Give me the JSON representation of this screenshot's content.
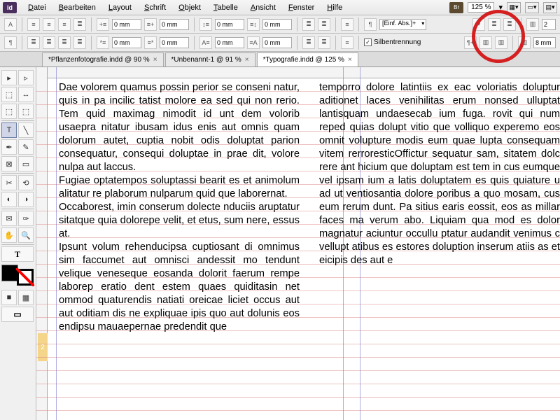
{
  "app_logo": "Id",
  "menu": [
    "Datei",
    "Bearbeiten",
    "Layout",
    "Schrift",
    "Objekt",
    "Tabelle",
    "Ansicht",
    "Fenster",
    "Hilfe"
  ],
  "bridge_badge": "Br",
  "zoom": "125 %",
  "control_bar": {
    "A_label": "A",
    "indent_left": "0 mm",
    "indent_right": "0 mm",
    "first_line": "0 mm",
    "space_before": "0 mm",
    "space_after": "0 mm",
    "para_style": "[Einf. Abs.]+",
    "hyphenation_label": "Silbentrennung",
    "hyphenation_checked": true,
    "columns": "2",
    "gutter": "8 mm"
  },
  "tabs": [
    {
      "label": "*Pflanzenfotografie.indd @ 90 %",
      "active": false
    },
    {
      "label": "*Unbenannt-1 @ 91 %",
      "active": false
    },
    {
      "label": "*Typografie.indd @ 125 %",
      "active": true
    }
  ],
  "page_number": "2",
  "text": {
    "col1_p1": "Dae volorem quamus possin perior se conseni na­tur, quis in pa incilic tatist molore ea sed qui non rerio. Tem quid maximag nimodit id unt dem vo­lorib usaepra nitatur ibusam idus enis aut omnis quam dolorum autet, cuptia nobit odis doluptat parion consequatur, consequi doluptae in prae dit, volore nulpa aut laccus.",
    "col1_p2": "Fugiae optatempos soluptassi bearit es et animo­lum alitatur re plaborum nulparum quid que la­borernat.",
    "col1_p3": "Occaborest, imin conserum dolecte nduciis arup­tatur sitatque quia dolorepe velit, et etus, sum ne­re, essus at.",
    "col1_p4": "Ipsunt volum rehenducipsa cuptiosant di omni­mus sim faccumet aut omnisci andessit mo tend­unt velique veneseque eosanda dolorit faerum rempe laborep eratio dent estem quaes quiditasin net ommod quaturendis natiati oreicae liciet oc­cus aut aut oditiam dis ne expliquae ipis quo aut dolunis eos endipsu mauaepernae predendit que",
    "col2_p1": "temporro dolore latintiis ex eac voloriatis doluptur aditionet laces venihilitas erum nonsed ulluptat lantisquam undaesecab ium fuga. rovit qui num reped quias dolupt vitio que volliquo experemo eos omnit volupture modis eum quae lupta consequam vitem rerroresticOffictur sequatur sam, sitatem dolc rere ant hicium que doluptam est tem in cus eumque vel ipsam ium a latis doluptatem es quis quiature u ad ut ventiosantia dolore poribus a quo mosam, cus eum rerum dunt. Pa sitius earis eossit, eos as millar faces ma verum abo. Liquiam qua mod es dolor magnatur aciuntur occullu ptatur audandit venimus c vellupt atibus es estores doluption inserum atiis as et eicipis des aut e"
  }
}
